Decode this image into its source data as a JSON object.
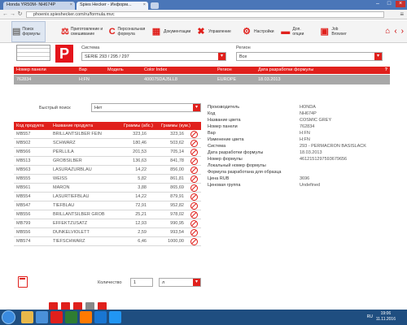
{
  "browser": {
    "tabs": [
      {
        "title": "Honda YR50M- NH674P"
      },
      {
        "title": "Spies Hecker - Информ..."
      }
    ],
    "url": "phoenix.spieshecker.com/ru/formula.mvc"
  },
  "toolbar": {
    "items": [
      {
        "label": "Поиск формулы"
      },
      {
        "label": "Приготовление и смешивание"
      },
      {
        "label": "Персональная формула"
      },
      {
        "label": "Документации"
      },
      {
        "label": "Управление"
      },
      {
        "label": "Настройки"
      },
      {
        "label": "Доп. опции"
      },
      {
        "label": "Job Browser"
      }
    ]
  },
  "filters": {
    "system_label": "Система",
    "system_value": "SERIE 293 / 295 / 297",
    "region_label": "Регион",
    "region_value": "Все"
  },
  "summary_table": {
    "headers": [
      "Номер панели",
      "Вар",
      "Модель",
      "Color Index",
      "Регион",
      "Дата разработки формулы"
    ],
    "help": "?",
    "row": [
      "762834",
      "H:FN",
      "",
      "400075DAJ5LL8",
      "EUROPE",
      "18.03.2013"
    ]
  },
  "quick_search": {
    "label": "Быстрый поиск",
    "value": "Нет"
  },
  "formula_table": {
    "headers": [
      "Код продукта",
      "Название продукта",
      "Граммы (абс.)",
      "Граммы (кум.)"
    ],
    "rows": [
      [
        "MB557",
        "BRILLANTSILBER FEIN",
        "323,16",
        "323,16"
      ],
      [
        "MB502",
        "SCHWARZ",
        "180,46",
        "503,62"
      ],
      [
        "MB566",
        "PERLLILA",
        "201,53",
        "705,14"
      ],
      [
        "MB513",
        "GROBSILBER",
        "136,63",
        "841,78"
      ],
      [
        "MB563",
        "LASURAZURBLAU",
        "14,22",
        "856,00"
      ],
      [
        "MB555",
        "WEISS",
        "5,82",
        "861,81"
      ],
      [
        "MB561",
        "MARON",
        "3,88",
        "865,69"
      ],
      [
        "MB554",
        "LASURTIEFBLAU",
        "14,22",
        "879,91"
      ],
      [
        "MB547",
        "TIEFBLAU",
        "72,91",
        "952,82"
      ],
      [
        "MB556",
        "BRILLANTSILBER GROB",
        "25,21",
        "978,02"
      ],
      [
        "MB799",
        "EFFEKTZUSATZ",
        "12,93",
        "990,95"
      ],
      [
        "MB556",
        "DUNKELVIOLETT",
        "2,59",
        "993,54"
      ],
      [
        "MB574",
        "TIEFSCHWARZ",
        "6,46",
        "1000,00"
      ]
    ]
  },
  "info": [
    [
      "Производитель",
      "HONDA"
    ],
    [
      "Код",
      "NH674P"
    ],
    [
      "Название цвета",
      "COSMIC GREY"
    ],
    [
      "Номер панели",
      "762834"
    ],
    [
      "Вар",
      "H:FN"
    ],
    [
      "Изменение цвета",
      "H:FN"
    ],
    [
      "Система",
      "293 - PERMACRON BASISLACK"
    ],
    [
      "Дата разработки формулы",
      "18.03.2013"
    ],
    [
      "Номер формулы",
      "4612151297593679656"
    ],
    [
      "Локальный номер формулы",
      ""
    ],
    [
      "Формула разработана для образца",
      ""
    ],
    [
      "Цена RUB",
      "3696"
    ],
    [
      "Ценовая группа",
      "Undefined"
    ]
  ],
  "quantity": {
    "label": "Количество",
    "value": "1",
    "unit": "л"
  },
  "taskbar": {
    "time": "19:06",
    "date": "11.11.2016",
    "lang": "RU"
  }
}
